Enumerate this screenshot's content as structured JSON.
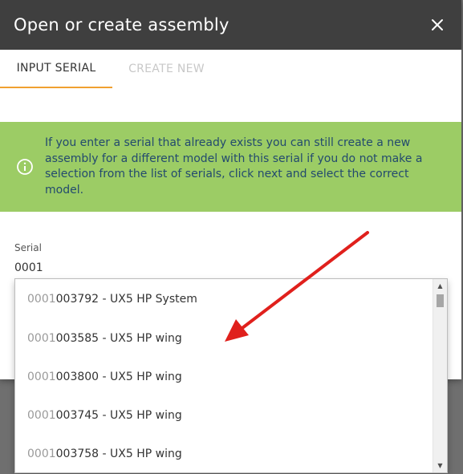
{
  "dialog": {
    "title": "Open or create assembly",
    "close_icon": "close-icon"
  },
  "tabs": [
    {
      "label": "INPUT SERIAL",
      "active": true
    },
    {
      "label": "CREATE NEW",
      "active": false
    }
  ],
  "banner": {
    "icon": "info-icon",
    "text": "If you enter a serial that already exists you can still create a new assembly for a different model with this serial if you do not make a selection from the list of serials, click next and select the correct model.",
    "color": "#9ccc65"
  },
  "serial_field": {
    "label": "Serial",
    "value": "0001"
  },
  "suggestions": [
    {
      "match": "0001",
      "rest": "003792 - UX5 HP System"
    },
    {
      "match": "0001",
      "rest": "003585 - UX5 HP wing"
    },
    {
      "match": "0001",
      "rest": "003800 - UX5 HP wing"
    },
    {
      "match": "0001",
      "rest": "003745 - UX5 HP wing"
    },
    {
      "match": "0001",
      "rest": "003758 - UX5 HP wing"
    }
  ],
  "colors": {
    "titlebar": "#3f3f3f",
    "tab_indicator": "#f0a030",
    "annotation_arrow": "#e0201c"
  }
}
